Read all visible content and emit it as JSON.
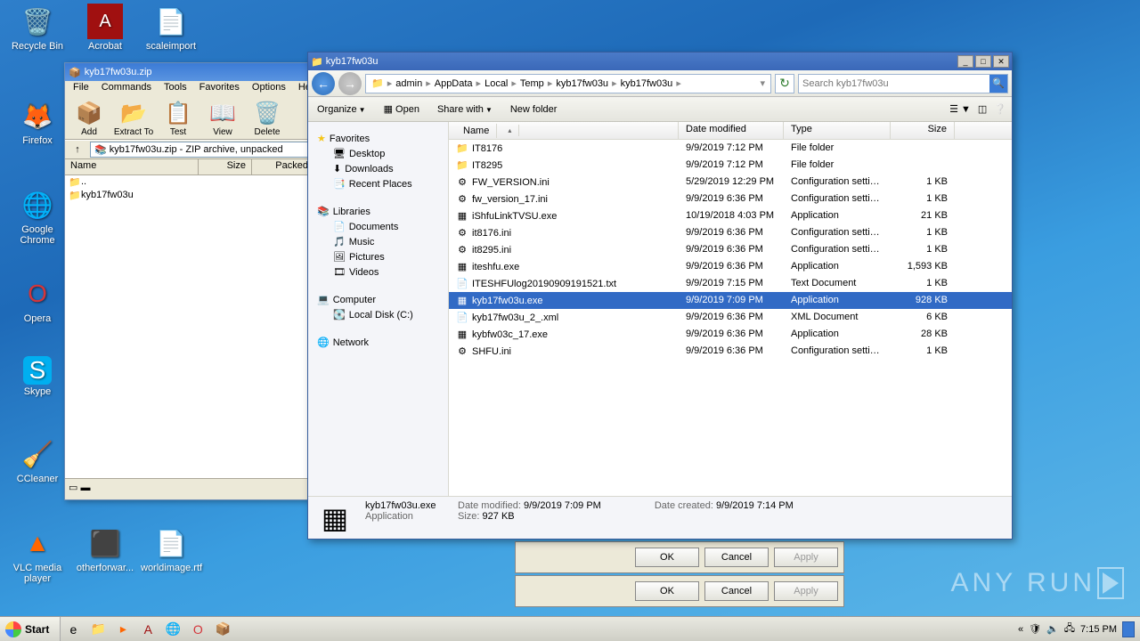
{
  "desktop": {
    "icons": [
      {
        "label": "Recycle Bin",
        "glyph": "🗑️"
      },
      {
        "label": "Acrobat",
        "glyph": "📕"
      },
      {
        "label": "scaleimport",
        "glyph": "📄"
      },
      {
        "label": "Firefox",
        "glyph": "🦊"
      },
      {
        "label": "Google Chrome",
        "glyph": "🌐"
      },
      {
        "label": "Opera",
        "glyph": "🅾️"
      },
      {
        "label": "Skype",
        "glyph": "Ⓢ"
      },
      {
        "label": "CCleaner",
        "glyph": "🧹"
      },
      {
        "label": "VLC media player",
        "glyph": "🔶"
      },
      {
        "label": "otherforwar...",
        "glyph": "⬛"
      },
      {
        "label": "worldimage.rtf",
        "glyph": "📄"
      }
    ]
  },
  "winrar": {
    "title": "kyb17fw03u.zip",
    "menu": [
      "File",
      "Commands",
      "Tools",
      "Favorites",
      "Options",
      "Help"
    ],
    "tools": [
      {
        "label": "Add",
        "glyph": "📦"
      },
      {
        "label": "Extract To",
        "glyph": "📂"
      },
      {
        "label": "Test",
        "glyph": "📋"
      },
      {
        "label": "View",
        "glyph": "📖"
      },
      {
        "label": "Delete",
        "glyph": "🗑️"
      }
    ],
    "path": "kyb17fw03u.zip - ZIP archive, unpacked",
    "cols": {
      "name": "Name",
      "size": "Size",
      "packed": "Packed"
    },
    "rows": [
      {
        "name": "..",
        "glyph": "📁"
      },
      {
        "name": "kyb17fw03u",
        "glyph": "📁"
      }
    ]
  },
  "explorer": {
    "title": "kyb17fw03u",
    "breadcrumb": [
      "admin",
      "AppData",
      "Local",
      "Temp",
      "kyb17fw03u",
      "kyb17fw03u"
    ],
    "search_placeholder": "Search kyb17fw03u",
    "cmds": {
      "organize": "Organize",
      "open": "Open",
      "share": "Share with",
      "newfolder": "New folder"
    },
    "side": {
      "favorites": "Favorites",
      "fav_items": [
        "Desktop",
        "Downloads",
        "Recent Places"
      ],
      "libraries": "Libraries",
      "lib_items": [
        "Documents",
        "Music",
        "Pictures",
        "Videos"
      ],
      "computer": "Computer",
      "comp_items": [
        "Local Disk (C:)"
      ],
      "network": "Network"
    },
    "cols": {
      "name": "Name",
      "date": "Date modified",
      "type": "Type",
      "size": "Size"
    },
    "files": [
      {
        "name": "IT8176",
        "date": "9/9/2019 7:12 PM",
        "type": "File folder",
        "size": "",
        "glyph": "📁"
      },
      {
        "name": "IT8295",
        "date": "9/9/2019 7:12 PM",
        "type": "File folder",
        "size": "",
        "glyph": "📁"
      },
      {
        "name": "FW_VERSION.ini",
        "date": "5/29/2019 12:29 PM",
        "type": "Configuration settings",
        "size": "1 KB",
        "glyph": "⚙"
      },
      {
        "name": "fw_version_17.ini",
        "date": "9/9/2019 6:36 PM",
        "type": "Configuration settings",
        "size": "1 KB",
        "glyph": "⚙"
      },
      {
        "name": "iShfuLinkTVSU.exe",
        "date": "10/19/2018 4:03 PM",
        "type": "Application",
        "size": "21 KB",
        "glyph": "▦"
      },
      {
        "name": "it8176.ini",
        "date": "9/9/2019 6:36 PM",
        "type": "Configuration settings",
        "size": "1 KB",
        "glyph": "⚙"
      },
      {
        "name": "it8295.ini",
        "date": "9/9/2019 6:36 PM",
        "type": "Configuration settings",
        "size": "1 KB",
        "glyph": "⚙"
      },
      {
        "name": "iteshfu.exe",
        "date": "9/9/2019 6:36 PM",
        "type": "Application",
        "size": "1,593 KB",
        "glyph": "▦"
      },
      {
        "name": "ITESHFUlog20190909191521.txt",
        "date": "9/9/2019 7:15 PM",
        "type": "Text Document",
        "size": "1 KB",
        "glyph": "📄"
      },
      {
        "name": "kyb17fw03u.exe",
        "date": "9/9/2019 7:09 PM",
        "type": "Application",
        "size": "928 KB",
        "glyph": "▦",
        "selected": true
      },
      {
        "name": "kyb17fw03u_2_.xml",
        "date": "9/9/2019 6:36 PM",
        "type": "XML Document",
        "size": "6 KB",
        "glyph": "📄"
      },
      {
        "name": "kybfw03c_17.exe",
        "date": "9/9/2019 6:36 PM",
        "type": "Application",
        "size": "28 KB",
        "glyph": "▦"
      },
      {
        "name": "SHFU.ini",
        "date": "9/9/2019 6:36 PM",
        "type": "Configuration settings",
        "size": "1 KB",
        "glyph": "⚙"
      }
    ],
    "details": {
      "name": "kyb17fw03u.exe",
      "type": "Application",
      "mod_label": "Date modified:",
      "mod": "9/9/2019 7:09 PM",
      "size_label": "Size:",
      "size": "927 KB",
      "created_label": "Date created:",
      "created": "9/9/2019 7:14 PM"
    }
  },
  "dlg": {
    "ok": "OK",
    "cancel": "Cancel",
    "apply": "Apply"
  },
  "taskbar": {
    "start": "Start",
    "time": "7:15 PM"
  },
  "watermark": "ANY   RUN"
}
